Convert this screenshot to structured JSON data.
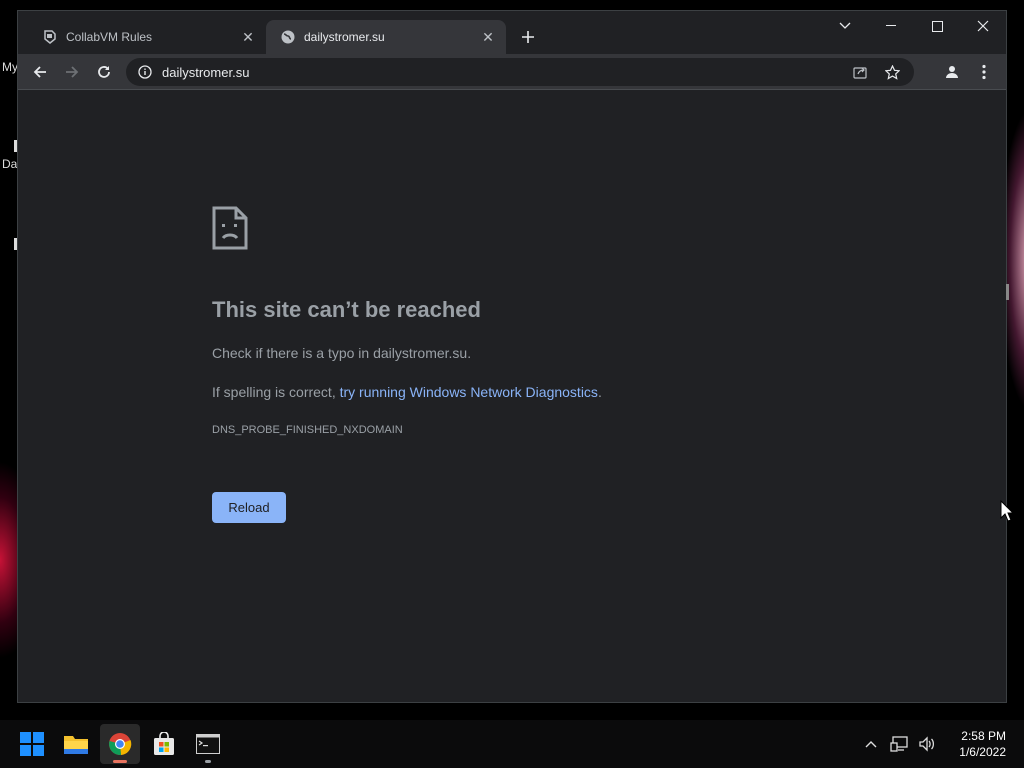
{
  "desktop": {
    "label_1": "My",
    "label_2": "Da"
  },
  "browser": {
    "tabs": [
      {
        "title": "CollabVM Rules",
        "icon": "collabvm-icon",
        "active": false
      },
      {
        "title": "dailystromer.su",
        "icon": "globe-icon",
        "active": true
      }
    ],
    "address_bar": {
      "url": "dailystromer.su"
    },
    "colors": {
      "accent": "#8ab4f8",
      "background": "#202124",
      "toolbar": "#35363a"
    }
  },
  "error_page": {
    "title": "This site can’t be reached",
    "line1": "Check if there is a typo in dailystromer.su.",
    "line2_prefix": "If spelling is correct, ",
    "line2_link": "try running Windows Network Diagnostics",
    "line2_suffix": ".",
    "error_code": "DNS_PROBE_FINISHED_NXDOMAIN",
    "reload_label": "Reload"
  },
  "taskbar": {
    "apps": [
      "start",
      "file-explorer",
      "chrome",
      "microsoft-store",
      "terminal"
    ],
    "clock": {
      "time": "2:58 PM",
      "date": "1/6/2022"
    }
  }
}
